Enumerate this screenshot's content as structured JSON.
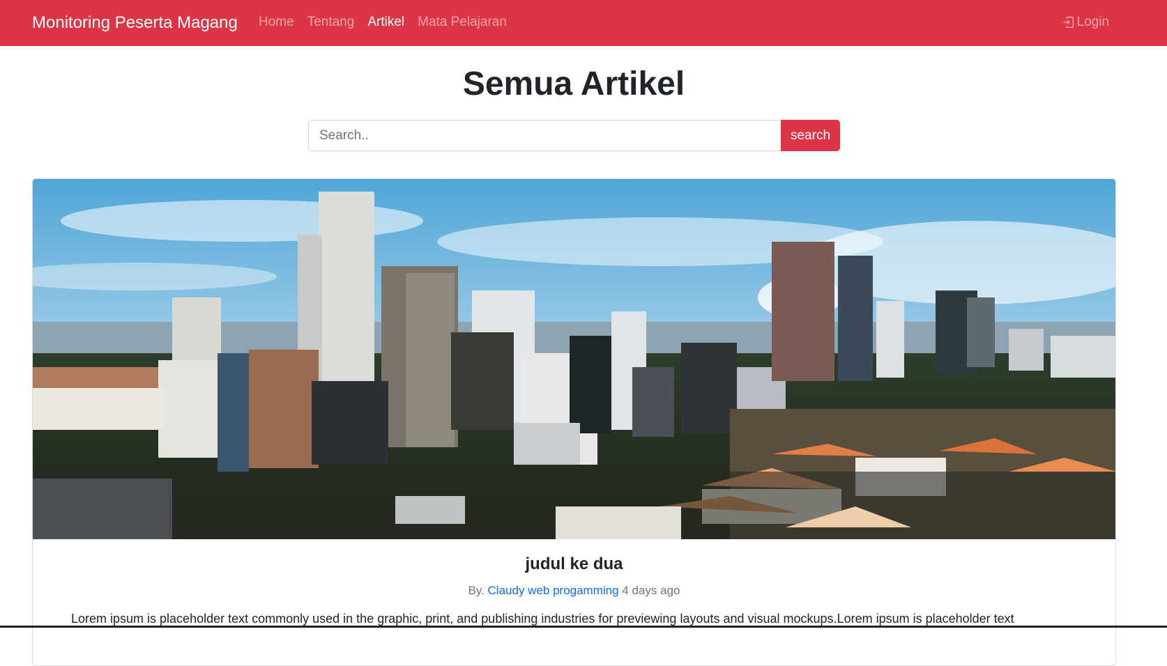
{
  "navbar": {
    "brand": "Monitoring Peserta Magang",
    "links": [
      {
        "label": "Home",
        "active": false
      },
      {
        "label": "Tentang",
        "active": false
      },
      {
        "label": "Artikel",
        "active": true
      },
      {
        "label": "Mata Pelajaran",
        "active": false
      }
    ],
    "login_label": "Login",
    "login_icon": "box-arrow-in-right-icon"
  },
  "main": {
    "title": "Semua Artikel",
    "search": {
      "placeholder": "Search..",
      "value": "",
      "button_label": "search"
    }
  },
  "articles": [
    {
      "title": "judul ke dua",
      "by_prefix": "By.",
      "author": "Claudy web progamming",
      "time": "4 days ago",
      "excerpt": "Lorem ipsum is placeholder text commonly used in the graphic, print, and publishing industries for previewing layouts and visual mockups.Lorem ipsum is placeholder text"
    }
  ],
  "colors": {
    "brand_red": "#dc3545",
    "link_blue": "#0d6efd",
    "muted_gray": "#6c757d"
  }
}
